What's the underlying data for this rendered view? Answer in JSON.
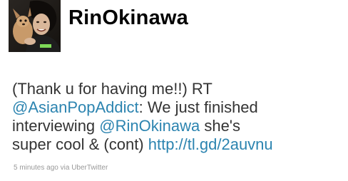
{
  "profile": {
    "screen_name": "RinOkinawa",
    "avatar_icon": "user-avatar-photo"
  },
  "tweet": {
    "line1": "(Thank u for having me!!) RT",
    "mention1": "@AsianPopAddict",
    "line2_rest": ": We just finished",
    "line3_prefix": "interviewing ",
    "mention2": "@RinOkinawa",
    "line3_suffix": " she's",
    "line4_prefix": "super cool & (cont) ",
    "link": "http://tl.gd/2auvnu"
  },
  "meta": {
    "timestamp": "5 minutes ago",
    "via_label": "via",
    "source": "UberTwitter"
  },
  "colors": {
    "link": "#2c84b0",
    "text": "#333333",
    "meta": "#999999"
  }
}
